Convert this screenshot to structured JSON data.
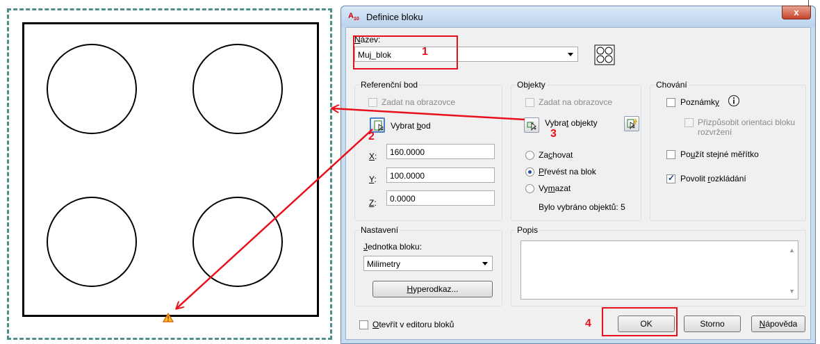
{
  "dialog": {
    "title": "Definice bloku",
    "app_icon_text": "A",
    "app_icon_sub": "10",
    "close_label": "x",
    "name_label_pre": "N",
    "name_label_accel": "á",
    "name_label_post": "zev:",
    "name_value": "Muj_blok",
    "ref_point": {
      "title": "Referenční bod",
      "on_screen": "Zadat na obrazovce",
      "pick_pre": "Vybrat ",
      "pick_accel": "b",
      "pick_post": "od",
      "x_label": "X",
      "y_label": "Y",
      "z_label": "Z",
      "x_value": "160.0000",
      "y_value": "100.0000",
      "z_value": "0.0000"
    },
    "objects": {
      "title": "Objekty",
      "on_screen": "Zadat na obrazovce",
      "select_pre": "Vybra",
      "select_accel": "t",
      "select_post": " objekty",
      "retain_pre": "Za",
      "retain_accel": "c",
      "retain_post": "hovat",
      "convert_accel": "P",
      "convert_post": "řevést na blok",
      "delete_pre": "Vy",
      "delete_accel": "m",
      "delete_post": "azat",
      "selected_count": "Bylo vybráno objektů: 5",
      "retain_checked": false,
      "convert_checked": true,
      "delete_checked": false
    },
    "behavior": {
      "title": "Chování",
      "annotative_pre": "Poznámk",
      "annotative_accel": "y",
      "match_orientation_line1": "Přizpůsobit orientaci bloku",
      "match_orientation_line2": "rozvržení",
      "uniform_scale_pre": "Po",
      "uniform_scale_accel": "u",
      "uniform_scale_post": "žít stejné měřítko",
      "allow_explode_pre": "Povolit ",
      "allow_explode_accel": "r",
      "allow_explode_post": "ozkládání",
      "annotative_checked": false,
      "uniform_checked": false,
      "explode_checked": true
    },
    "settings": {
      "title": "Nastavení",
      "unit_label_accel": "J",
      "unit_label_post": "ednotka bloku:",
      "unit_value": "Milimetry",
      "hyperlink_accel": "H",
      "hyperlink_post": "yperodkaz..."
    },
    "description": {
      "title": "Popis",
      "value": ""
    },
    "open_editor_accel": "O",
    "open_editor_post": "tevřít v editoru bloků",
    "open_editor_checked": false,
    "ok_label": "OK",
    "cancel_label": "Storno",
    "help_accel": "N",
    "help_post": "ápověda"
  },
  "annotations": {
    "n1": "1",
    "n2": "2",
    "n3": "3",
    "n4": "4",
    "color": "#e8101a"
  },
  "canvas": {
    "frame_color": "#4f8f8a"
  }
}
